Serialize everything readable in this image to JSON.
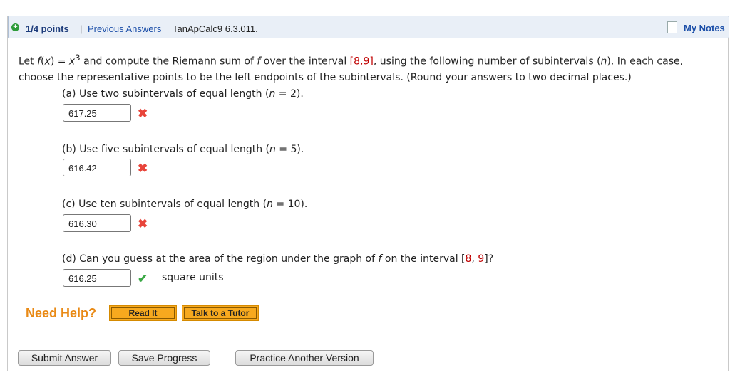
{
  "header": {
    "points": "1/4 points",
    "separator": "|",
    "previous_answers": "Previous Answers",
    "problem_id": "TanApCalc9 6.3.011.",
    "my_notes": "My Notes"
  },
  "question": {
    "intro_1": "Let ",
    "f_name": "f",
    "intro_2": "(",
    "var_x": "x",
    "intro_3": ") = ",
    "var_x2": "x",
    "exp": "3",
    "intro_4": " and compute the Riemann sum of ",
    "f_name2": "f",
    "intro_5": " over the interval ",
    "interval": "[8,9]",
    "intro_6": ", using the following number of subintervals (",
    "var_n": "n",
    "intro_7": "). In each case, choose the representative points to be the left endpoints of the subintervals. (Round your answers to two decimal places.)"
  },
  "parts": [
    {
      "prefix": "(a) Use two subintervals of equal length (",
      "n": "n",
      "suffix": " = 2).",
      "answer": "617.25",
      "correct": false
    },
    {
      "prefix": "(b) Use five subintervals of equal length (",
      "n": "n",
      "suffix": " = 5).",
      "answer": "616.42",
      "correct": false
    },
    {
      "prefix": "(c) Use ten subintervals of equal length (",
      "n": "n",
      "suffix": " = 10).",
      "answer": "616.30",
      "correct": false
    }
  ],
  "part_d": {
    "prefix": "(d) Can you guess at the area of the region under the graph of ",
    "f_name": "f",
    "mid": " on the interval [",
    "a": "8",
    "comma": ", ",
    "b": "9",
    "suffix": "]?",
    "answer": "616.25",
    "units": "square units",
    "correct": true
  },
  "help": {
    "label": "Need Help?",
    "read_it": "Read It",
    "talk_tutor": "Talk to a Tutor"
  },
  "actions": {
    "submit": "Submit Answer",
    "save": "Save Progress",
    "practice": "Practice Another Version"
  },
  "marks": {
    "wrong": "✖",
    "right": "✔"
  },
  "colors": {
    "header_bg": "#e9eff7",
    "link": "#1b4ea8",
    "wrong": "#e8443a",
    "right": "#3aa845",
    "help": "#e98a16",
    "interval_red": "#c00000"
  }
}
